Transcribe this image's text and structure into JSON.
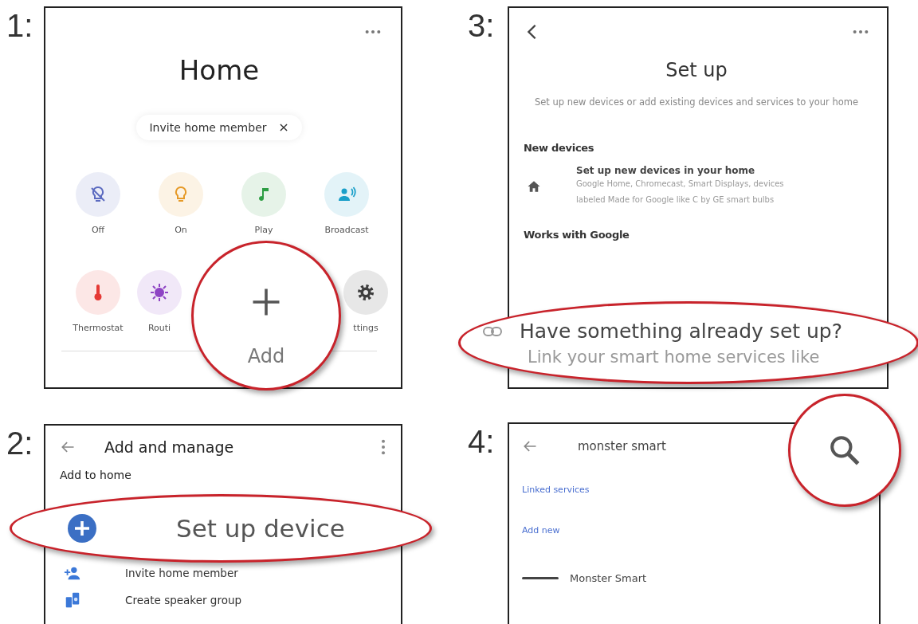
{
  "home_screen": {
    "step_label": "1:",
    "title": "Home",
    "chip": {
      "label": "Invite home member"
    },
    "tile_rows": [
      [
        {
          "kind": "light-off",
          "label": "Off",
          "color": "#5c6bc0"
        },
        {
          "kind": "light",
          "label": "On",
          "color": "#e69a28"
        },
        {
          "kind": "music",
          "label": "Play",
          "color": "#2e9e44"
        },
        {
          "kind": "broadcast",
          "label": "Broadcast",
          "color": "#1a9fc9"
        }
      ],
      [
        {
          "kind": "thermometer",
          "label": "Thermostat",
          "color": "#e53935"
        },
        {
          "kind": "routine",
          "label": "Routi",
          "color": "#8e44c4"
        },
        {
          "kind": "gear",
          "label": "ttings",
          "color": "#3c3c3c"
        }
      ]
    ],
    "callout": {
      "label": "Add"
    }
  },
  "setup_screen": {
    "step_label": "3:",
    "title": "Set up",
    "subtitle": "Set up new devices or add existing devices and services to your home",
    "sections": [
      {
        "heading": "New devices",
        "items": [
          {
            "title": "Set up new devices in your home",
            "description": "Google Home, Chromecast, Smart Displays, devices labeled Made for Google like C by GE smart bulbs"
          }
        ]
      },
      {
        "heading": "Works with Google"
      }
    ],
    "callout": {
      "title": "Have something already set up?",
      "text": "Link your smart home services like"
    }
  },
  "manage_screen": {
    "step_label": "2:",
    "title": "Add and manage",
    "section": "Add to home",
    "callout": {
      "label": "Set up device"
    },
    "items": [
      {
        "kind": "person-add",
        "label": "Invite home member"
      },
      {
        "kind": "speaker-group",
        "label": "Create speaker group"
      }
    ]
  },
  "search_screen": {
    "step_label": "4:",
    "query": "monster smart",
    "links": [
      "Linked services",
      "Add new"
    ],
    "results": [
      {
        "label": "Monster Smart"
      }
    ]
  }
}
